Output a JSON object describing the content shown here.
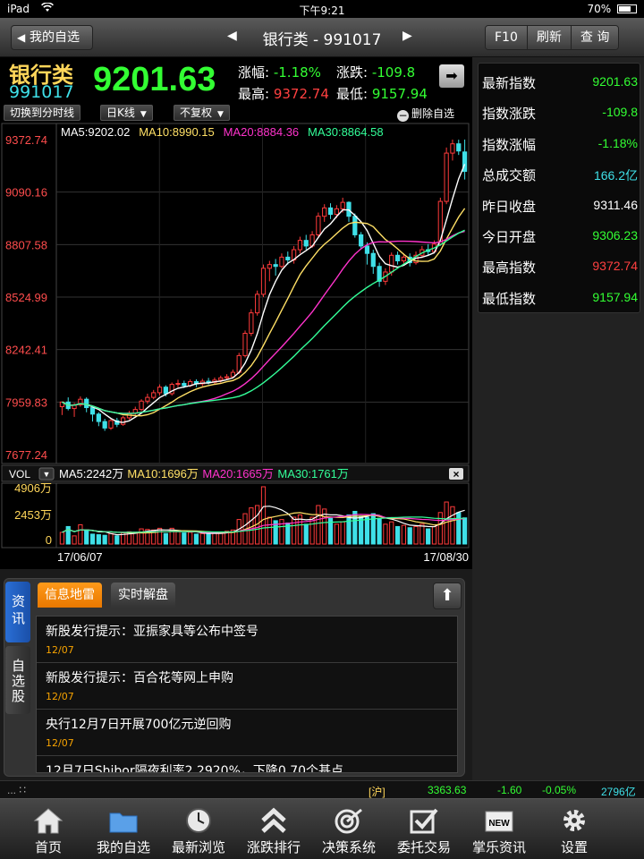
{
  "status_bar": {
    "device": "iPad",
    "time": "下午9:21",
    "battery": "70%",
    "battery_level": 0.7
  },
  "nav": {
    "back_label": "我的自选",
    "title": "银行类 - 991017",
    "f10_label": "F10",
    "refresh_label": "刷新",
    "query_label": "查 询"
  },
  "quote": {
    "name": "银行类",
    "code": "991017",
    "price": "9201.63",
    "change_pct_label": "涨幅:",
    "change_pct": "-1.18%",
    "change_label": "涨跌:",
    "change": "-109.8",
    "high_label": "最高:",
    "high": "9372.74",
    "low_label": "最低:",
    "low": "9157.94"
  },
  "controls": {
    "timeshare_label": "切换到分时线",
    "period_label": "日K线",
    "adjust_label": "不复权",
    "delete_label": "删除自选"
  },
  "chart_data": {
    "type": "candlestick",
    "x_start": "17/06/07",
    "x_end": "17/08/30",
    "price_ticks": [
      "9372.74",
      "9090.16",
      "8807.58",
      "8524.99",
      "8242.41",
      "7959.83",
      "7677.24"
    ],
    "ylim": [
      7677.24,
      9372.74
    ],
    "ma_legend": [
      {
        "label": "MA5:9202.02",
        "color": "#ffffff"
      },
      {
        "label": "MA10:8990.15",
        "color": "#ffe066"
      },
      {
        "label": "MA20:8884.36",
        "color": "#ff33cc"
      },
      {
        "label": "MA30:8864.58",
        "color": "#33ff99"
      }
    ],
    "candles": [
      [
        7935,
        7960,
        7960,
        7890
      ],
      [
        7960,
        7925,
        7985,
        7915
      ],
      [
        7925,
        7945,
        7955,
        7880
      ],
      [
        7945,
        7975,
        7990,
        7935
      ],
      [
        7975,
        7930,
        7985,
        7905
      ],
      [
        7930,
        7895,
        7940,
        7855
      ],
      [
        7895,
        7855,
        7905,
        7830
      ],
      [
        7855,
        7820,
        7870,
        7805
      ],
      [
        7820,
        7860,
        7872,
        7810
      ],
      [
        7860,
        7840,
        7875,
        7825
      ],
      [
        7840,
        7875,
        7885,
        7832
      ],
      [
        7875,
        7900,
        7912,
        7865
      ],
      [
        7900,
        7920,
        7935,
        7890
      ],
      [
        7920,
        7965,
        7975,
        7910
      ],
      [
        7965,
        7985,
        8005,
        7950
      ],
      [
        7985,
        8010,
        8025,
        7975
      ],
      [
        8010,
        8040,
        8055,
        7995
      ],
      [
        8040,
        8005,
        8050,
        7990
      ],
      [
        8005,
        8055,
        8065,
        7995
      ],
      [
        8055,
        8060,
        8080,
        8040
      ],
      [
        8060,
        8048,
        8075,
        8035
      ],
      [
        8048,
        8070,
        8082,
        8040
      ],
      [
        8070,
        8058,
        8082,
        8040
      ],
      [
        8058,
        8072,
        8085,
        8045
      ],
      [
        8072,
        8066,
        8090,
        8055
      ],
      [
        8066,
        8078,
        8092,
        8055
      ],
      [
        8078,
        8090,
        8102,
        8065
      ],
      [
        8090,
        8096,
        8110,
        8080
      ],
      [
        8096,
        8120,
        8135,
        8088
      ],
      [
        8120,
        8210,
        8225,
        8110
      ],
      [
        8210,
        8330,
        8345,
        8200
      ],
      [
        8330,
        8440,
        8460,
        8315
      ],
      [
        8440,
        8540,
        8560,
        8425
      ],
      [
        8540,
        8680,
        8700,
        8525
      ],
      [
        8680,
        8700,
        8720,
        8610
      ],
      [
        8700,
        8690,
        8730,
        8640
      ],
      [
        8690,
        8740,
        8760,
        8680
      ],
      [
        8740,
        8725,
        8770,
        8700
      ],
      [
        8725,
        8780,
        8800,
        8705
      ],
      [
        8780,
        8830,
        8850,
        8760
      ],
      [
        8830,
        8800,
        8860,
        8780
      ],
      [
        8800,
        8860,
        8880,
        8790
      ],
      [
        8860,
        8960,
        8980,
        8845
      ],
      [
        8960,
        9005,
        9025,
        8930
      ],
      [
        9005,
        8970,
        9030,
        8945
      ],
      [
        8970,
        9000,
        9020,
        8950
      ],
      [
        9000,
        9035,
        9060,
        8980
      ],
      [
        9035,
        8960,
        9040,
        8930
      ],
      [
        8960,
        8860,
        8975,
        8845
      ],
      [
        8860,
        8800,
        8875,
        8780
      ],
      [
        8800,
        8760,
        8820,
        8700
      ],
      [
        8760,
        8690,
        8780,
        8650
      ],
      [
        8690,
        8610,
        8710,
        8580
      ],
      [
        8610,
        8660,
        8680,
        8590
      ],
      [
        8660,
        8750,
        8765,
        8640
      ],
      [
        8750,
        8720,
        8770,
        8700
      ],
      [
        8720,
        8740,
        8760,
        8705
      ],
      [
        8740,
        8710,
        8760,
        8690
      ],
      [
        8710,
        8750,
        8770,
        8700
      ],
      [
        8750,
        8780,
        8800,
        8735
      ],
      [
        8780,
        8770,
        8810,
        8750
      ],
      [
        8770,
        8810,
        8830,
        8760
      ],
      [
        8810,
        9040,
        9060,
        8800
      ],
      [
        9040,
        9300,
        9330,
        9025
      ],
      [
        9300,
        9350,
        9372.74,
        9260
      ],
      [
        9350,
        9311.46,
        9372,
        9290
      ],
      [
        9306.23,
        9201.63,
        9372.74,
        9157.94
      ]
    ],
    "vol_legend": [
      {
        "label": "MA5:2242万",
        "color": "#ffffff"
      },
      {
        "label": "MA10:1696万",
        "color": "#ffe066"
      },
      {
        "label": "MA20:1665万",
        "color": "#ff33cc"
      },
      {
        "label": "MA30:1761万",
        "color": "#33ff99"
      }
    ],
    "vol_ticks": [
      "4906万",
      "2453万",
      "0"
    ],
    "vol_max": 4906,
    "volumes": [
      1000,
      1500,
      700,
      1650,
      1200,
      850,
      800,
      750,
      900,
      700,
      950,
      1050,
      1000,
      1300,
      1250,
      1200,
      1350,
      900,
      1350,
      1050,
      950,
      1000,
      850,
      900,
      850,
      950,
      1000,
      1100,
      1200,
      2100,
      2600,
      3100,
      3300,
      4906,
      2300,
      2000,
      2100,
      1800,
      2300,
      2500,
      1700,
      2300,
      3300,
      3000,
      2200,
      1700,
      1900,
      2500,
      2800,
      2400,
      2300,
      2600,
      2200,
      1700,
      1900,
      1500,
      1600,
      1400,
      1500,
      1700,
      1300,
      1500,
      2700,
      3600,
      3200,
      2700,
      2242
    ],
    "vol_label": "VOL"
  },
  "right_panel": [
    {
      "label": "最新指数",
      "value": "9201.63",
      "color": "#33ff33"
    },
    {
      "label": "指数涨跌",
      "value": "-109.8",
      "color": "#33ff33"
    },
    {
      "label": "指数涨幅",
      "value": "-1.18%",
      "color": "#33ff33"
    },
    {
      "label": "总成交额",
      "value": "166.2亿",
      "color": "#3fe0e8"
    },
    {
      "label": "昨日收盘",
      "value": "9311.46",
      "color": "#ffffff"
    },
    {
      "label": "今日开盘",
      "value": "9306.23",
      "color": "#33ff33"
    },
    {
      "label": "最高指数",
      "value": "9372.74",
      "color": "#ff4040"
    },
    {
      "label": "最低指数",
      "value": "9157.94",
      "color": "#33ff33"
    }
  ],
  "news": {
    "side_tab_active": "资讯",
    "side_tab_inactive": "自选股",
    "tab_active": "信息地雷",
    "tab_inactive": "实时解盘",
    "items": [
      {
        "title": "新股发行提示：亚振家具等公布中签号",
        "date": "12/07"
      },
      {
        "title": "新股发行提示：百合花等网上申购",
        "date": "12/07"
      },
      {
        "title": "央行12月7日开展700亿元逆回购",
        "date": "12/07"
      },
      {
        "title": "12月7日Shibor隔夜利率2.2920%，下降0.70个基点",
        "date": ""
      }
    ]
  },
  "ticker": {
    "dots": "... ∷",
    "market": "[沪]",
    "index": "3363.63",
    "change": "-1.60",
    "pct": "-0.05%",
    "amount": "2796亿"
  },
  "tabbar": [
    {
      "label": "首页",
      "icon": "home-icon"
    },
    {
      "label": "我的自选",
      "icon": "folder-icon"
    },
    {
      "label": "最新浏览",
      "icon": "clock-icon"
    },
    {
      "label": "涨跌排行",
      "icon": "chevrons-up-icon"
    },
    {
      "label": "决策系统",
      "icon": "target-icon"
    },
    {
      "label": "委托交易",
      "icon": "checkbox-icon"
    },
    {
      "label": "掌乐资讯",
      "icon": "new-badge-icon"
    },
    {
      "label": "设置",
      "icon": "gear-icon"
    }
  ]
}
